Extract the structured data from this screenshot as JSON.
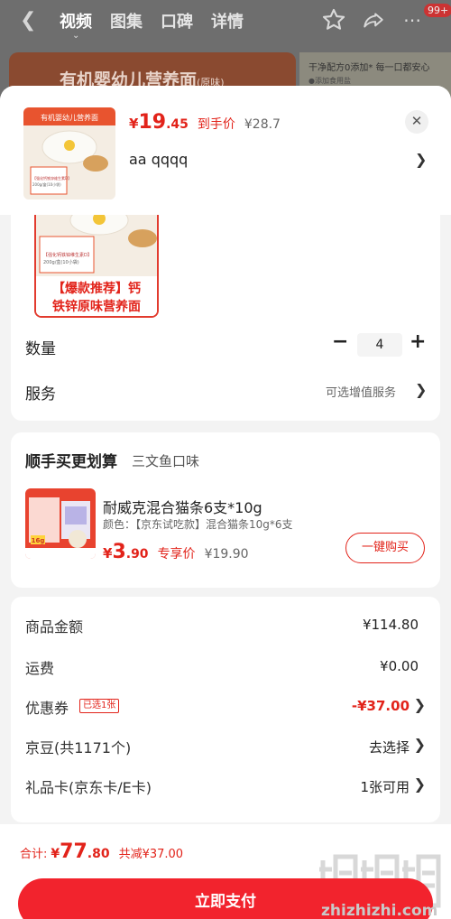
{
  "background": {
    "tabs": [
      "视频",
      "图集",
      "口碑",
      "详情"
    ],
    "badge": "99+",
    "banner": "有机婴幼儿营养面",
    "banner_sub": "(原味)",
    "side_text": "干净配方0添加* 每一口都安心",
    "side_sub": "●添加食用盐"
  },
  "product": {
    "price_currency": "¥",
    "price_int": "19",
    "price_dec": ".45",
    "price_label": "到手价",
    "original_price": "¥28.7",
    "spec": "aa  qqqq",
    "thumb_title": "有机婴幼儿营养面",
    "thumb_sub": "(原味)",
    "thumb_pack_line1": "【强化钙铁锌维生素D】",
    "thumb_pack_line2": "200g/盒(10小袋)",
    "big_label_line1": "【爆款推荐】钙",
    "big_label_line2": "铁锌原味营养面",
    "big_pack_line1": "【强化钙铁锌维生素D】",
    "big_pack_line2": "200g/盒(10小袋)"
  },
  "quantity": {
    "label": "数量",
    "minus": "−",
    "value": "4",
    "plus": "+"
  },
  "service": {
    "label": "服务",
    "value": "可选增值服务"
  },
  "addon": {
    "title": "顺手买更划算",
    "subtitle": "三文鱼口味",
    "name": "耐威克混合猫条6支*10g",
    "spec": "颜色：【京东试吃款】混合猫条10g*6支",
    "price_currency": "¥",
    "price_int": "3",
    "price_dec": ".90",
    "price_label": "专享价",
    "original_price": "¥19.90",
    "buy_label": "一键购买",
    "thumb_badge": "16g"
  },
  "fees": {
    "goods_label": "商品金额",
    "goods_value": "¥114.80",
    "shipping_label": "运费",
    "shipping_value": "¥0.00",
    "coupon_label": "优惠券",
    "coupon_tag": "已选1张",
    "coupon_value": "-¥37.00",
    "jingdou_label": "京豆(共1171个)",
    "jingdou_value": "去选择",
    "giftcard_label": "礼品卡(京东卡/E卡)",
    "giftcard_value": "1张可用"
  },
  "footer": {
    "total_label": "合计:",
    "total_currency": "¥",
    "total_int": "77",
    "total_dec": ".80",
    "save": "共减¥37.00",
    "pay_button": "立即支付",
    "watermark": "zhizhizhi.com"
  },
  "icons": {
    "back": "back-chevron",
    "star": "star-outline",
    "share": "share-arrow",
    "more": "more-dots",
    "close": "close-x",
    "chevron": "chevron-right"
  },
  "colors": {
    "accent": "#e2231a",
    "pay_button": "#f2232d"
  }
}
